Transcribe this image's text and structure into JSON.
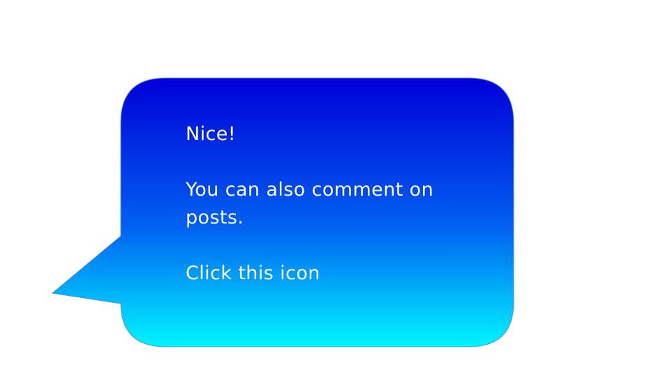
{
  "tooltip": {
    "heading": "Nice!",
    "body": "You can also comment on posts.",
    "instruction": "Click this icon"
  },
  "colors": {
    "gradient_top": "#0000d8",
    "gradient_bottom": "#00f4ff",
    "text": "#ffffff",
    "background": "#ffffff"
  }
}
